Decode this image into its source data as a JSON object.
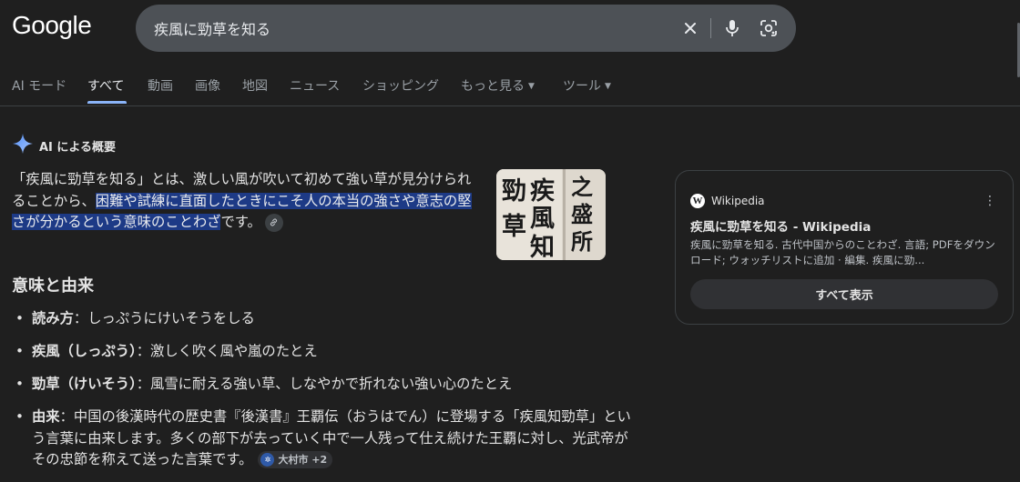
{
  "logo": "Google",
  "search": {
    "query": "疾風に勁草を知る"
  },
  "search_icons": {
    "clear": "close-icon",
    "voice": "microphone-icon",
    "lens": "lens-icon"
  },
  "tabs": [
    {
      "label": "AI モード"
    },
    {
      "label": "すべて",
      "active": true
    },
    {
      "label": "動画"
    },
    {
      "label": "画像"
    },
    {
      "label": "地図"
    },
    {
      "label": "ニュース"
    },
    {
      "label": "ショッピング"
    },
    {
      "label": "もっと見る",
      "dropdown": true
    },
    {
      "label": "ツール",
      "dropdown": true
    }
  ],
  "ai_overview": {
    "heading": "AI による概要",
    "intro_plain": "「疾風に勁草を知る」とは、激しい風が吹いて初めて強い草が見分けられることから、",
    "intro_highlight": "困難や試練に直面したときにこそ人の本当の強さや意志の堅さが分かるという意味のことわざ",
    "intro_end": "です。",
    "image_text": "疾風知勁草 之盛所",
    "section_title": "意味と由来",
    "bullets": [
      {
        "term": "読み方",
        "sep": "：",
        "text": "しっぷうにけいそうをしる"
      },
      {
        "term": "疾風（しっぷう）",
        "sep": "：",
        "text": "激しく吹く風や嵐のたとえ"
      },
      {
        "term": "勁草（けいそう）",
        "sep": "：",
        "text": "風雪に耐える強い草、しなやかで折れない強い心のたとえ"
      },
      {
        "term": "由来",
        "sep": "：",
        "text": "中国の後漢時代の歴史書『後漢書』王覇伝（おうはでん）に登場する「疾風知勁草」という言葉に由来します。多くの部下が去っていく中で一人残って仕え続けた王覇に対し、光武帝がその忠節を称えて送った言葉です。"
      }
    ],
    "source_chip": "大村市 +2"
  },
  "wiki_card": {
    "source": "Wikipedia",
    "title": "疾風に勁草を知る - Wikipedia",
    "snippet": "疾風に勁草を知る. 古代中国からのことわざ. 言語; PDFをダウンロード; ウォッチリストに追加 · 編集. 疾風に勁...",
    "button": "すべて表示"
  },
  "colors": {
    "background": "#1f1f1f",
    "search_bg": "#4d5156",
    "highlight": "#1d3a86",
    "active_tab_underline": "#8ab4f8",
    "card_border": "#3c4043"
  }
}
